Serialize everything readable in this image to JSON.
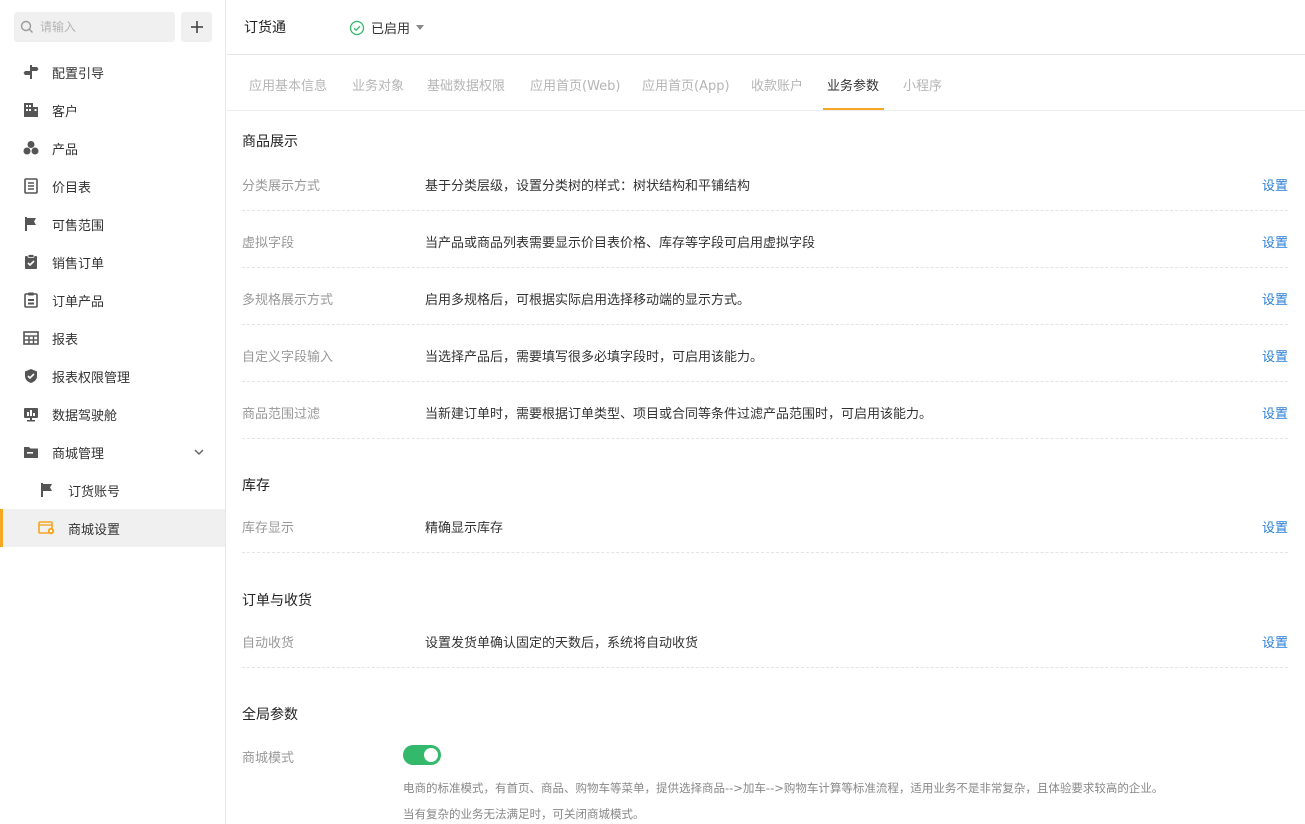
{
  "sidebar": {
    "search_placeholder": "请输入",
    "add_icon": "plus-icon",
    "items": [
      {
        "label": "配置引导",
        "icon": "signpost-icon"
      },
      {
        "label": "客户",
        "icon": "building-icon"
      },
      {
        "label": "产品",
        "icon": "cubes-icon"
      },
      {
        "label": "价目表",
        "icon": "document-list-icon"
      },
      {
        "label": "可售范围",
        "icon": "flag-icon"
      },
      {
        "label": "销售订单",
        "icon": "clipboard-check-icon"
      },
      {
        "label": "订单产品",
        "icon": "clipboard-list-icon"
      },
      {
        "label": "报表",
        "icon": "table-icon"
      },
      {
        "label": "报表权限管理",
        "icon": "shield-check-icon"
      },
      {
        "label": "数据驾驶舱",
        "icon": "dashboard-icon"
      },
      {
        "label": "商城管理",
        "icon": "folder-icon",
        "expanded": true
      },
      {
        "label": "订货账号",
        "icon": "flag-icon",
        "sub": true
      },
      {
        "label": "商城设置",
        "icon": "store-settings-icon",
        "sub": true,
        "active": true
      }
    ]
  },
  "header": {
    "title": "订货通",
    "status_label": "已启用"
  },
  "tabs": [
    {
      "label": "应用基本信息"
    },
    {
      "label": "业务对象"
    },
    {
      "label": "基础数据权限"
    },
    {
      "label": "应用首页(Web)"
    },
    {
      "label": "应用首页(App)"
    },
    {
      "label": "收款账户"
    },
    {
      "label": "业务参数",
      "active": true
    },
    {
      "label": "小程序"
    }
  ],
  "sections": {
    "product_display": {
      "title": "商品展示",
      "rows": [
        {
          "label": "分类展示方式",
          "desc": "基于分类层级，设置分类树的样式：树状结构和平铺结构",
          "action": "设置"
        },
        {
          "label": "虚拟字段",
          "desc": "当产品或商品列表需要显示价目表价格、库存等字段可启用虚拟字段",
          "action": "设置"
        },
        {
          "label": "多规格展示方式",
          "desc": "启用多规格后，可根据实际启用选择移动端的显示方式。",
          "action": "设置"
        },
        {
          "label": "自定义字段输入",
          "desc": "当选择产品后，需要填写很多必填字段时，可启用该能力。",
          "action": "设置"
        },
        {
          "label": "商品范围过滤",
          "desc": "当新建订单时，需要根据订单类型、项目或合同等条件过滤产品范围时，可启用该能力。",
          "action": "设置"
        }
      ]
    },
    "inventory": {
      "title": "库存",
      "rows": [
        {
          "label": "库存显示",
          "desc": "精确显示库存",
          "action": "设置"
        }
      ]
    },
    "order_receipt": {
      "title": "订单与收货",
      "rows": [
        {
          "label": "自动收货",
          "desc": "设置发货单确认固定的天数后，系统将自动收货",
          "action": "设置"
        }
      ]
    },
    "global": {
      "title": "全局参数",
      "mall_mode": {
        "label": "商城模式",
        "enabled": true,
        "desc_1": "电商的标准模式，有首页、商品、购物车等菜单，提供选择商品-->加车-->购物车计算等标准流程，适用业务不是非常复杂，且体验要求较高的企业。",
        "desc_2": "当有复杂的业务无法满足时，可关闭商城模式。"
      }
    }
  },
  "colors": {
    "accent": "#f5a623",
    "link": "#2b7fd6",
    "toggle_on": "#34b86b"
  }
}
